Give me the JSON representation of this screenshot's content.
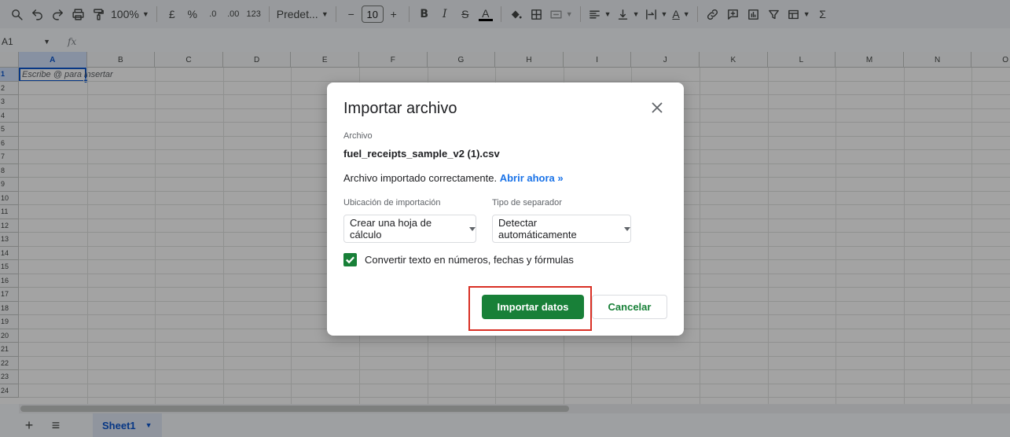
{
  "toolbar": {
    "zoom": "100%",
    "currency": "£",
    "percent": "%",
    "decrease_decimals": ".0",
    "increase_decimals": ".00",
    "number_format": "123",
    "font_name": "Predet...",
    "font_size_minus": "−",
    "font_size": "10",
    "font_size_plus": "+",
    "bold": "B",
    "italic": "I",
    "strikethrough": "S",
    "text_color_letter": "A",
    "text_rotation_letter": "A",
    "sum": "Σ",
    "text_color_bar": "#000000"
  },
  "formula_bar": {
    "name_box": "A1",
    "fx_label": "fx"
  },
  "grid": {
    "columns": [
      "A",
      "B",
      "C",
      "D",
      "E",
      "F",
      "G",
      "H",
      "I",
      "J",
      "K",
      "L",
      "M",
      "N",
      "O"
    ],
    "rows": [
      "1",
      "2",
      "3",
      "4",
      "5",
      "6",
      "7",
      "8",
      "9",
      "10",
      "11",
      "12",
      "13",
      "14",
      "15",
      "16",
      "17",
      "18",
      "19",
      "20",
      "21",
      "22",
      "23",
      "24"
    ],
    "selected_cell": "A1",
    "a1_placeholder": "Escribe @ para insertar"
  },
  "sheet_bar": {
    "add_sheet": "+",
    "all_sheets": "≡",
    "active_sheet": "Sheet1"
  },
  "dialog": {
    "title": "Importar archivo",
    "file_label": "Archivo",
    "file_name": "fuel_receipts_sample_v2 (1).csv",
    "status_text": "Archivo importado correctamente.",
    "open_link": "Abrir ahora »",
    "location_label": "Ubicación de importación",
    "location_value": "Crear una hoja de cálculo",
    "separator_label": "Tipo de separador",
    "separator_value": "Detectar automáticamente",
    "convert_label": "Convertir texto en números, fechas y fórmulas",
    "convert_checked": true,
    "import_button": "Importar datos",
    "cancel_button": "Cancelar"
  },
  "colors": {
    "primary_green": "#188038",
    "link_blue": "#1a73e8",
    "highlight_red": "#d93025",
    "selection_blue": "#0b57d0"
  }
}
